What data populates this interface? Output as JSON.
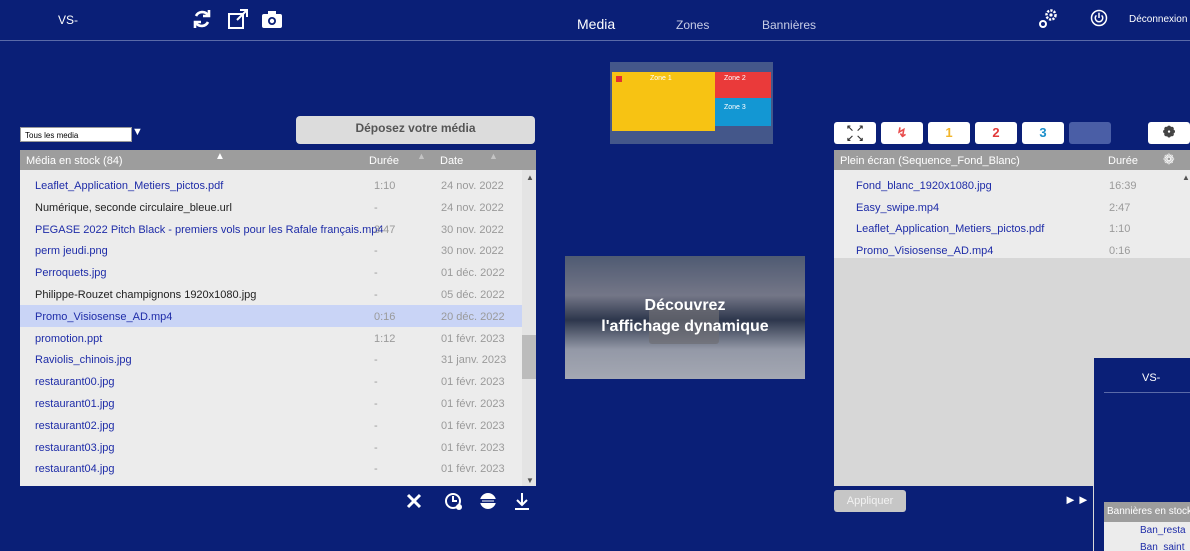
{
  "header": {
    "title": "VS-",
    "nav": [
      "Media",
      "Zones",
      "Bannières"
    ],
    "logout_label": "Déconnexion",
    "icons": [
      "refresh-icon",
      "external-link-icon",
      "camera-icon",
      "settings-gears-icon",
      "power-icon"
    ]
  },
  "left": {
    "filter_value": "Tous les media",
    "drop_label": "Déposez votre média",
    "header": {
      "name": "Média en stock (84)",
      "duration": "Durée",
      "date": "Date"
    },
    "rows": [
      {
        "name": "Leaflet_Application_Metiers_pictos.pdf",
        "duration": "1:10",
        "date": "24 nov. 2022"
      },
      {
        "name": "Numérique, seconde circulaire_bleue.url",
        "duration": "-",
        "date": "24 nov. 2022"
      },
      {
        "name": "PEGASE 2022 Pitch Black - premiers vols pour les Rafale français.mp4",
        "duration": "3:47",
        "date": "30 nov. 2022"
      },
      {
        "name": "perm jeudi.png",
        "duration": "-",
        "date": "30 nov. 2022"
      },
      {
        "name": "Perroquets.jpg",
        "duration": "-",
        "date": "01 déc. 2022"
      },
      {
        "name": "Philippe-Rouzet champignons 1920x1080.jpg",
        "duration": "-",
        "date": "05 déc. 2022"
      },
      {
        "name": "Promo_Visiosense_AD.mp4",
        "duration": "0:16",
        "date": "20 déc. 2022"
      },
      {
        "name": "promotion.ppt",
        "duration": "1:12",
        "date": "01 févr. 2023"
      },
      {
        "name": "Raviolis_chinois.jpg",
        "duration": "-",
        "date": "31 janv. 2023"
      },
      {
        "name": "restaurant00.jpg",
        "duration": "-",
        "date": "01 févr. 2023"
      },
      {
        "name": "restaurant01.jpg",
        "duration": "-",
        "date": "01 févr. 2023"
      },
      {
        "name": "restaurant02.jpg",
        "duration": "-",
        "date": "01 févr. 2023"
      },
      {
        "name": "restaurant03.jpg",
        "duration": "-",
        "date": "01 févr. 2023"
      },
      {
        "name": "restaurant04.jpg",
        "duration": "-",
        "date": "01 févr. 2023"
      }
    ],
    "selected_row": 6,
    "dark_rows": [
      1,
      5
    ],
    "action_icons": [
      "delete-icon",
      "schedule-icon",
      "web-icon",
      "download-icon"
    ]
  },
  "zones_preview": {
    "zone1": "Zone 1",
    "zone2": "Zone 2",
    "zone3": "Zone 3"
  },
  "preview": {
    "line1": "Découvrez",
    "line2": "l'affichage dynamique"
  },
  "right": {
    "tabs": [
      "fullscreen-icon",
      "no-layout-icon",
      "1",
      "2",
      "3",
      "",
      "film-reel-icon"
    ],
    "header": {
      "name": "Plein écran (Sequence_Fond_Blanc)",
      "duration": "Durée"
    },
    "rows": [
      {
        "name": "Fond_blanc_1920x1080.jpg",
        "duration": "16:39"
      },
      {
        "name": "Easy_swipe.mp4",
        "duration": "2:47"
      },
      {
        "name": "Leaflet_Application_Metiers_pictos.pdf",
        "duration": "1:10"
      },
      {
        "name": "Promo_Visiosense_AD.mp4",
        "duration": "0:16"
      }
    ],
    "apply_label": "Appliquer",
    "next_icon": "fast-forward-icon"
  },
  "popup": {
    "title": "VS-",
    "header": "Bannières en stock",
    "rows": [
      "Ban_resta",
      "Ban_saint"
    ]
  },
  "colors": {
    "background": "#0a1f77",
    "header_gray": "#9d9d9d",
    "link_blue": "#1e2ca8",
    "selected_row": "#c9d4f6",
    "zone1": "#f7c313",
    "zone2": "#ea3a3a",
    "zone3": "#1397d3"
  }
}
